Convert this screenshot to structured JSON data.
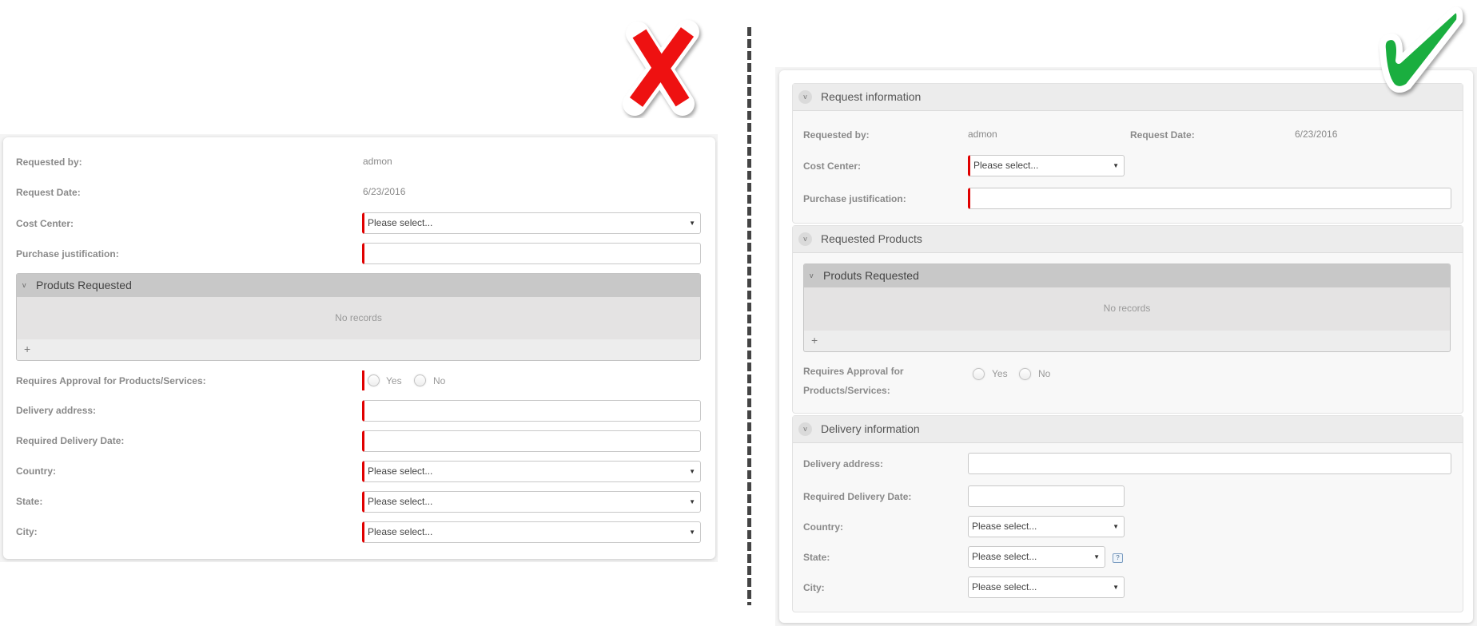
{
  "marks": {
    "bad": "cross-mark",
    "good": "check-mark",
    "bad_color": "#ee1111",
    "good_color": "#1aae3f"
  },
  "bad_form": {
    "requested_by_label": "Requested by:",
    "requested_by_value": "admon",
    "request_date_label": "Request Date:",
    "request_date_value": "6/23/2016",
    "cost_center_label": "Cost Center:",
    "cost_center_value": "Please select...",
    "purchase_justification_label": "Purchase justification:",
    "purchase_justification_value": "",
    "grid": {
      "title": "Produts Requested",
      "empty_text": "No records",
      "add_label": "+"
    },
    "requires_approval_label": "Requires Approval for Products/Services:",
    "radio_yes": "Yes",
    "radio_no": "No",
    "delivery_address_label": "Delivery address:",
    "delivery_address_value": "",
    "required_delivery_date_label": "Required Delivery Date:",
    "required_delivery_date_value": "",
    "country_label": "Country:",
    "country_value": "Please select...",
    "state_label": "State:",
    "state_value": "Please select...",
    "city_label": "City:",
    "city_value": "Please select..."
  },
  "good_form": {
    "sections": {
      "request_info": "Request information",
      "requested_products": "Requested Products",
      "delivery_info": "Delivery information"
    },
    "requested_by_label": "Requested by:",
    "requested_by_value": "admon",
    "request_date_label": "Request Date:",
    "request_date_value": "6/23/2016",
    "cost_center_label": "Cost Center:",
    "cost_center_value": "Please select...",
    "purchase_justification_label": "Purchase justification:",
    "grid": {
      "title": "Produts Requested",
      "empty_text": "No records",
      "add_label": "+"
    },
    "requires_approval_label_line1": "Requires Approval for",
    "requires_approval_label_line2": "Products/Services:",
    "radio_yes": "Yes",
    "radio_no": "No",
    "delivery_address_label": "Delivery address:",
    "required_delivery_date_label": "Required Delivery Date:",
    "country_label": "Country:",
    "country_value": "Please select...",
    "state_label": "State:",
    "state_value": "Please select...",
    "state_help": "?",
    "city_label": "City:",
    "city_value": "Please select..."
  },
  "icons": {
    "chevron": "v",
    "caret": "▼"
  }
}
